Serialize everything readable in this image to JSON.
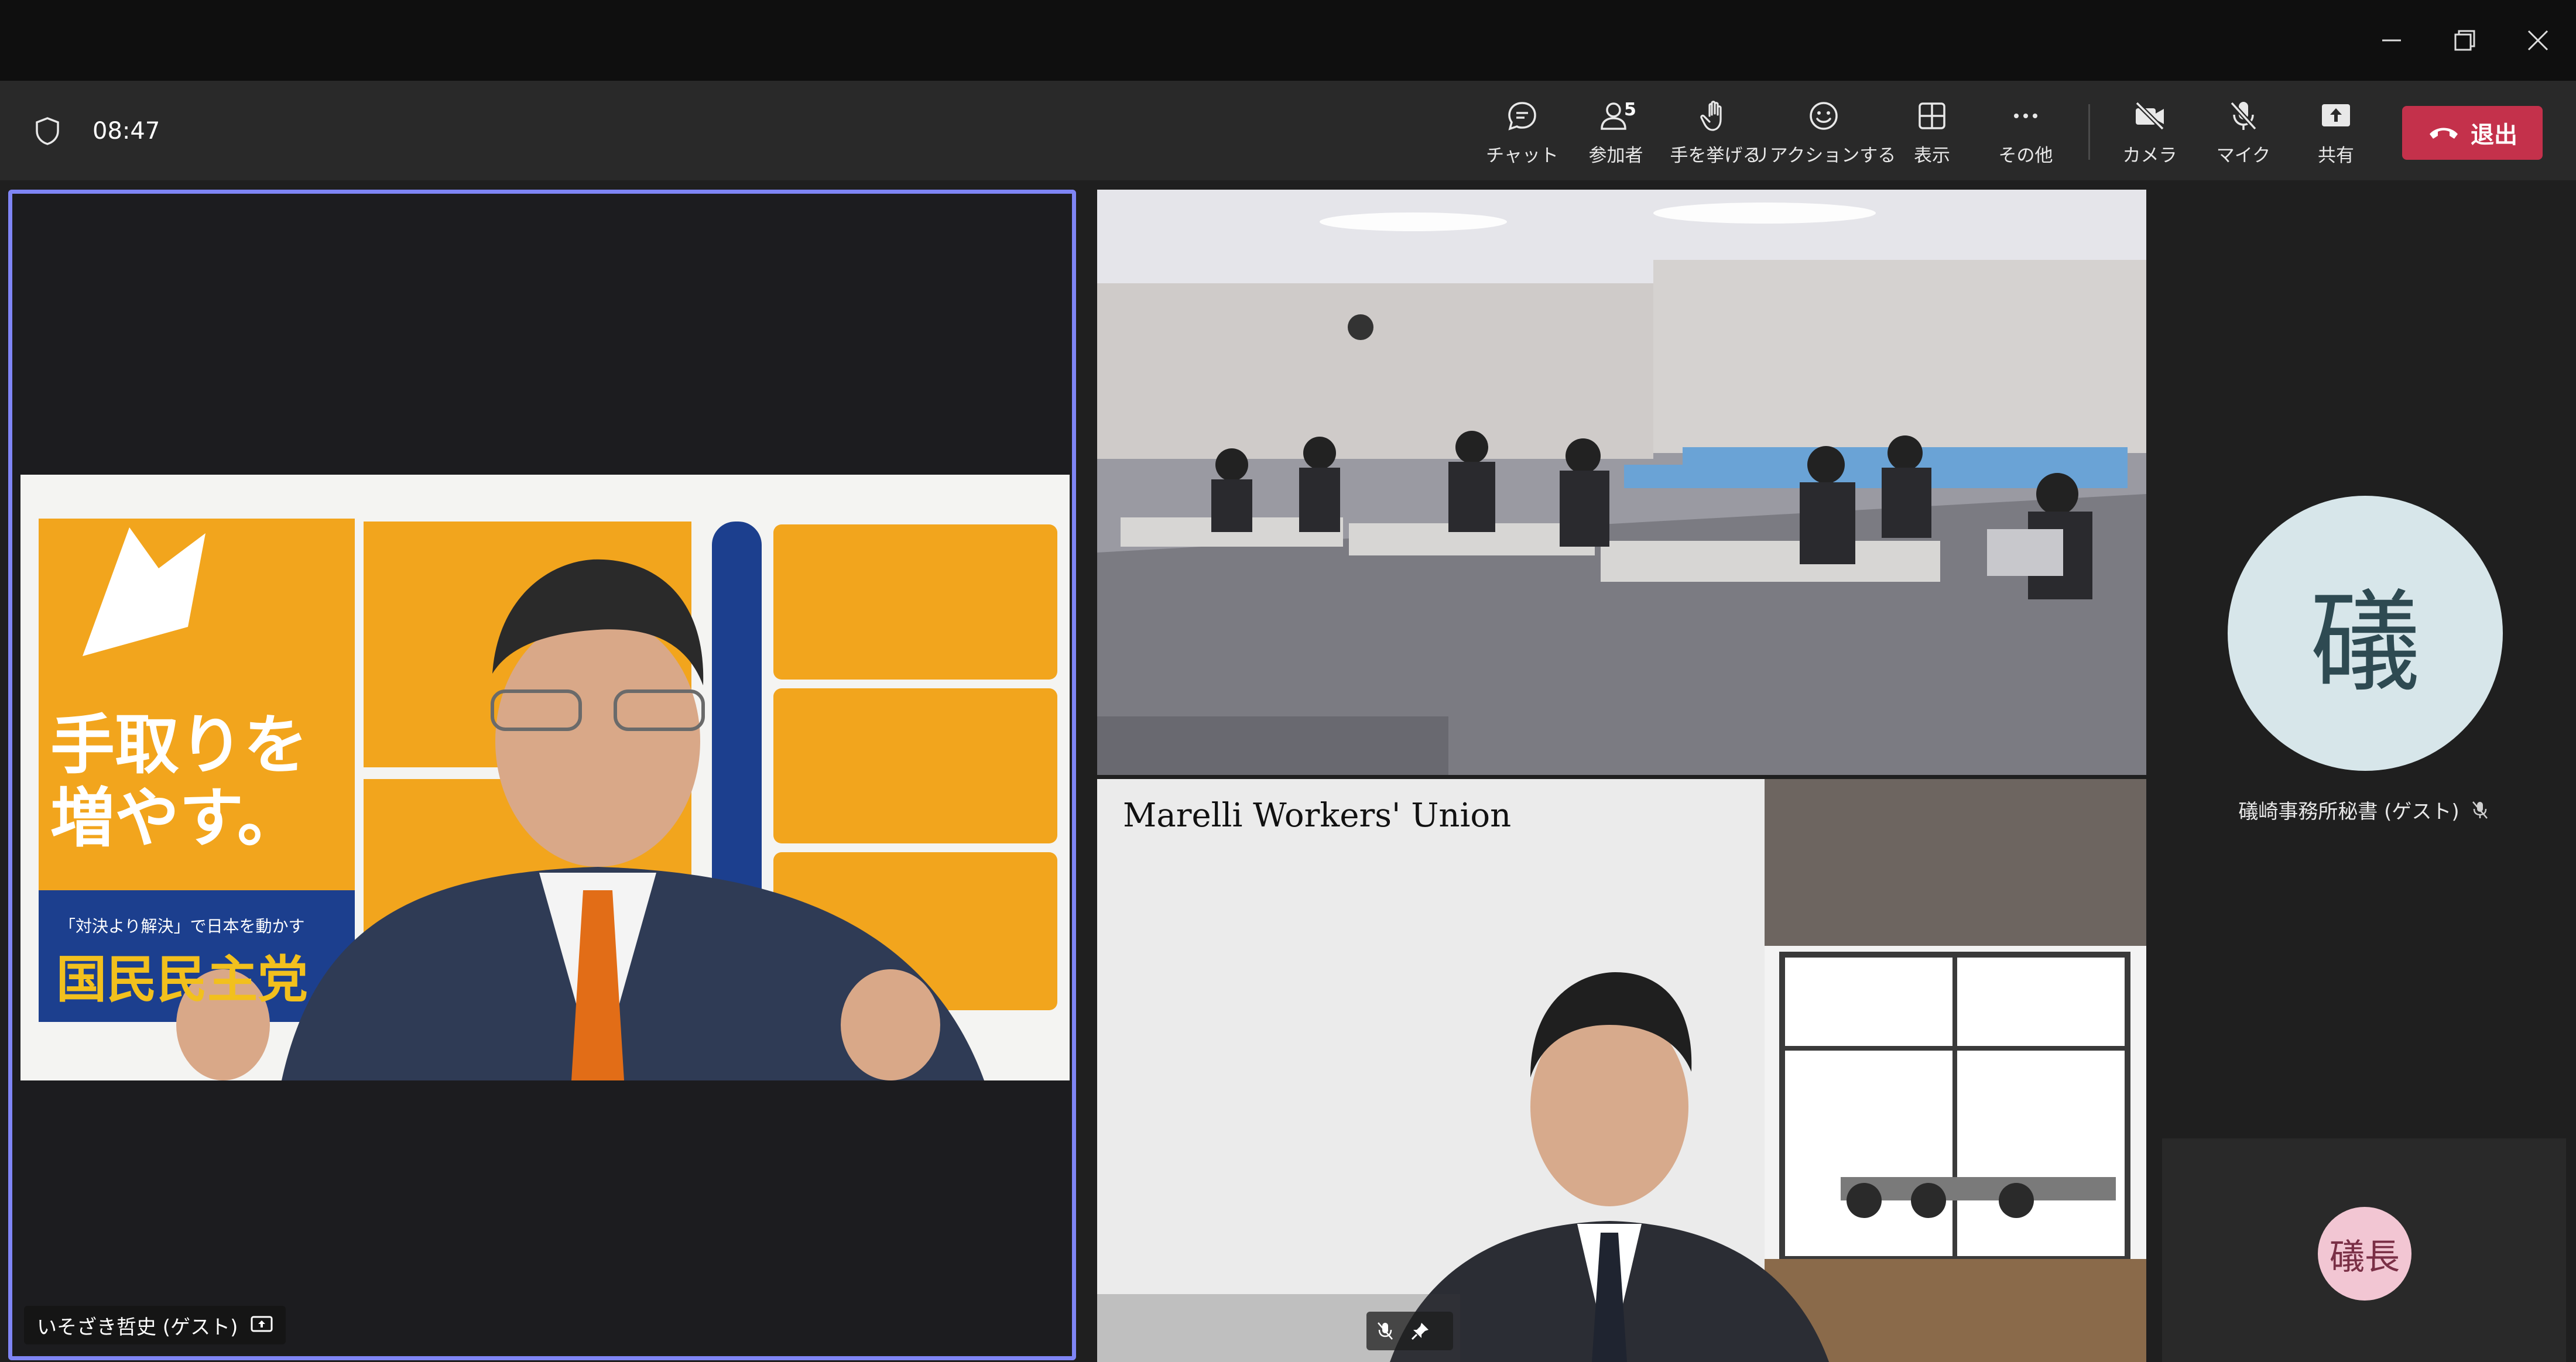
{
  "window": {
    "controls": [
      "minimize-icon",
      "maximize-icon",
      "close-icon"
    ]
  },
  "toolbar": {
    "timer": "08:47",
    "chat_label": "チャット",
    "people_label": "参加者",
    "people_count": "5",
    "raise_hand_label": "手を挙げる",
    "reactions_label": "リアクションする",
    "view_label": "表示",
    "more_label": "その他",
    "camera_label": "カメラ",
    "mic_label": "マイク",
    "share_label": "共有",
    "leave_label": "退出",
    "colors": {
      "leave": "#c4314b",
      "active_border": "#7f85f5"
    }
  },
  "participants": {
    "main": {
      "name": "いそざき哲史 (ゲスト)",
      "poster_text": "手取りを増やす。",
      "poster_slogan": "「対決より解決」で日本を動かす",
      "poster_party": "国民民主党"
    },
    "union": {
      "wall_text": "Marelli Workers' Union"
    },
    "avatar": {
      "initials": "礒",
      "name": "礒崎事務所秘書 (ゲスト)"
    },
    "mini": {
      "initials": "礒長"
    }
  }
}
